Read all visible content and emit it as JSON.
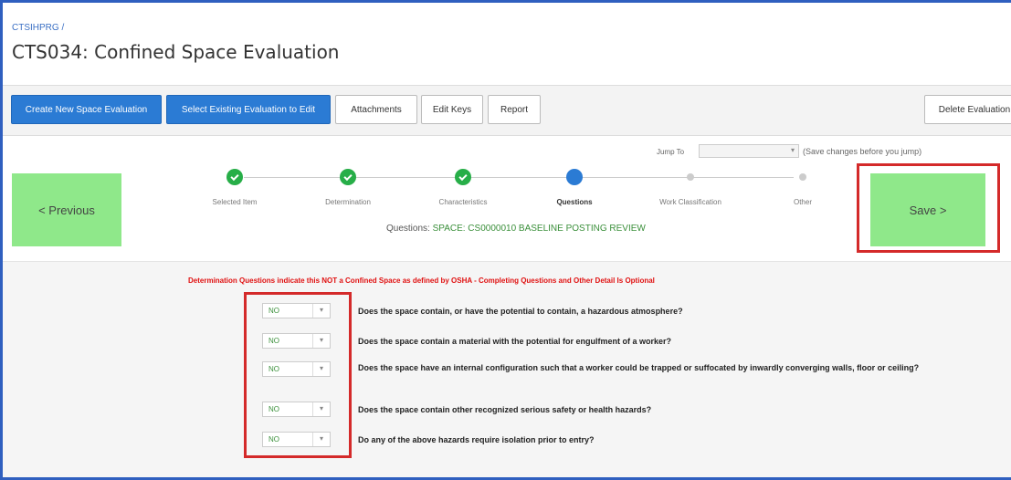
{
  "header": {
    "breadcrumb": "CTSIHPRG /",
    "title": "CTS034: Confined Space Evaluation"
  },
  "toolbar": {
    "create_new": "Create New Space Evaluation",
    "select_existing": "Select Existing Evaluation to Edit",
    "attachments": "Attachments",
    "edit_keys": "Edit Keys",
    "report": "Report",
    "delete": "Delete Evaluation"
  },
  "wizard": {
    "previous_label": "< Previous",
    "save_label": "Save >",
    "jump_to_label": "Jump To",
    "jump_to_value": "",
    "jump_note": "(Save changes before you jump)",
    "steps": [
      {
        "label": "Selected Item",
        "state": "done"
      },
      {
        "label": "Determination",
        "state": "done"
      },
      {
        "label": "Characteristics",
        "state": "done"
      },
      {
        "label": "Questions",
        "state": "current"
      },
      {
        "label": "Work Classification",
        "state": "future"
      },
      {
        "label": "Other",
        "state": "future"
      }
    ],
    "questions_prefix": "Questions:",
    "questions_value": "SPACE: CS0000010 BASELINE POSTING REVIEW"
  },
  "questions": {
    "warning": "Determination Questions indicate this NOT a Confined Space as defined by OSHA - Completing Questions and Other Detail Is Optional",
    "items": [
      {
        "answer": "NO",
        "text": "Does the space contain, or have the potential to contain, a hazardous atmosphere?"
      },
      {
        "answer": "NO",
        "text": "Does the space contain a material with the potential for engulfment of a worker?"
      },
      {
        "answer": "NO",
        "text": "Does the space have an internal configuration such that a worker could be trapped or suffocated by inwardly converging walls, floor or ceiling?"
      },
      {
        "answer": "NO",
        "text": "Does the space contain other recognized serious safety or health hazards?"
      },
      {
        "answer": "NO",
        "text": "Do any of the above hazards require isolation prior to entry?"
      }
    ]
  },
  "colors": {
    "primary_button": "#2b7bd4",
    "nav_button": "#8fe88a",
    "highlight_box": "#d42a2a",
    "step_done": "#27ae48",
    "step_current": "#2b7bd4",
    "warning_text": "#e01010"
  },
  "icons": {
    "step_done": "check-icon",
    "select_caret": "caret-down-icon"
  }
}
